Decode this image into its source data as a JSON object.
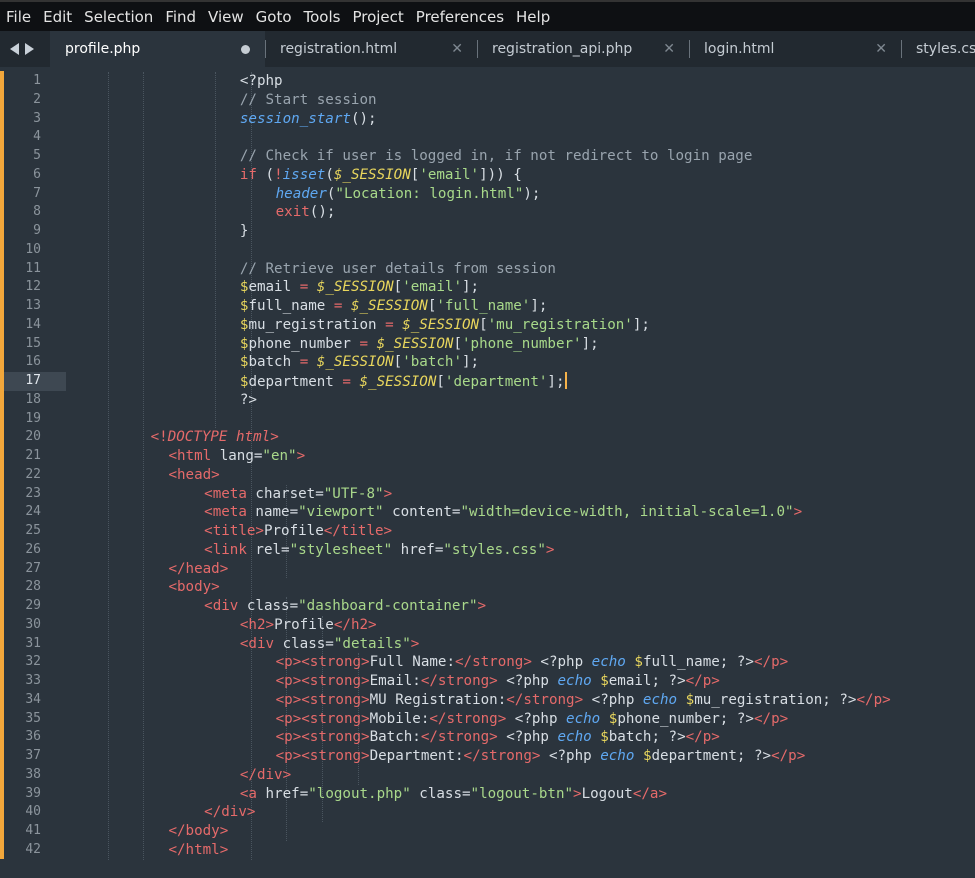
{
  "menu": [
    "File",
    "Edit",
    "Selection",
    "Find",
    "View",
    "Goto",
    "Tools",
    "Project",
    "Preferences",
    "Help"
  ],
  "tabs": [
    {
      "label": "profile.php",
      "active": true,
      "modified": true
    },
    {
      "label": "registration.html",
      "active": false,
      "modified": false
    },
    {
      "label": "registration_api.php",
      "active": false,
      "modified": false
    },
    {
      "label": "login.html",
      "active": false,
      "modified": false
    },
    {
      "label": "styles.css",
      "active": false,
      "modified": false
    }
  ],
  "editor": {
    "active_line": 17,
    "line_numbers": [
      "1",
      "2",
      "3",
      "4",
      "5",
      "6",
      "7",
      "8",
      "9",
      "10",
      "11",
      "12",
      "13",
      "14",
      "15",
      "16",
      "17",
      "18",
      "19",
      "20",
      "21",
      "22",
      "23",
      "24",
      "25",
      "26",
      "27",
      "28",
      "29",
      "30",
      "31",
      "32",
      "33",
      "34",
      "35",
      "36",
      "37",
      "38",
      "39",
      "40",
      "41",
      "42"
    ],
    "lines": [
      [
        [
          30,
          "php",
          "<?php"
        ]
      ],
      [
        [
          30,
          "comment",
          "// Start session"
        ]
      ],
      [
        [
          30,
          "func",
          "session_start"
        ],
        [
          0,
          "php",
          "();"
        ]
      ],
      [],
      [
        [
          30,
          "comment",
          "// Check if user is logged in, if not redirect to login page"
        ]
      ],
      [
        [
          30,
          "keyword",
          "if"
        ],
        [
          0,
          "php",
          " ("
        ],
        [
          0,
          "keyword",
          "!"
        ],
        [
          0,
          "func",
          "isset"
        ],
        [
          0,
          "php",
          "("
        ],
        [
          0,
          "super",
          "$_SESSION"
        ],
        [
          0,
          "php",
          "["
        ],
        [
          0,
          "string",
          "'email'"
        ],
        [
          0,
          "php",
          "])) {"
        ]
      ],
      [
        [
          34,
          "func",
          "header"
        ],
        [
          0,
          "php",
          "("
        ],
        [
          0,
          "string",
          "\"Location: login.html\""
        ],
        [
          0,
          "php",
          ");"
        ]
      ],
      [
        [
          34,
          "keyword",
          "exit"
        ],
        [
          0,
          "php",
          "();"
        ]
      ],
      [
        [
          30,
          "php",
          "}"
        ]
      ],
      [],
      [
        [
          30,
          "comment",
          "// Retrieve user details from session"
        ]
      ],
      [
        [
          30,
          "dollar",
          "$"
        ],
        [
          0,
          "php",
          "email "
        ],
        [
          0,
          "keyword",
          "="
        ],
        [
          0,
          "php",
          " "
        ],
        [
          0,
          "super",
          "$_SESSION"
        ],
        [
          0,
          "php",
          "["
        ],
        [
          0,
          "string",
          "'email'"
        ],
        [
          0,
          "php",
          "];"
        ]
      ],
      [
        [
          30,
          "dollar",
          "$"
        ],
        [
          0,
          "php",
          "full_name "
        ],
        [
          0,
          "keyword",
          "="
        ],
        [
          0,
          "php",
          " "
        ],
        [
          0,
          "super",
          "$_SESSION"
        ],
        [
          0,
          "php",
          "["
        ],
        [
          0,
          "string",
          "'full_name'"
        ],
        [
          0,
          "php",
          "];"
        ]
      ],
      [
        [
          30,
          "dollar",
          "$"
        ],
        [
          0,
          "php",
          "mu_registration "
        ],
        [
          0,
          "keyword",
          "="
        ],
        [
          0,
          "php",
          " "
        ],
        [
          0,
          "super",
          "$_SESSION"
        ],
        [
          0,
          "php",
          "["
        ],
        [
          0,
          "string",
          "'mu_registration'"
        ],
        [
          0,
          "php",
          "];"
        ]
      ],
      [
        [
          30,
          "dollar",
          "$"
        ],
        [
          0,
          "php",
          "phone_number "
        ],
        [
          0,
          "keyword",
          "="
        ],
        [
          0,
          "php",
          " "
        ],
        [
          0,
          "super",
          "$_SESSION"
        ],
        [
          0,
          "php",
          "["
        ],
        [
          0,
          "string",
          "'phone_number'"
        ],
        [
          0,
          "php",
          "];"
        ]
      ],
      [
        [
          30,
          "dollar",
          "$"
        ],
        [
          0,
          "php",
          "batch "
        ],
        [
          0,
          "keyword",
          "="
        ],
        [
          0,
          "php",
          " "
        ],
        [
          0,
          "super",
          "$_SESSION"
        ],
        [
          0,
          "php",
          "["
        ],
        [
          0,
          "string",
          "'batch'"
        ],
        [
          0,
          "php",
          "];"
        ]
      ],
      [
        [
          30,
          "dollar",
          "$"
        ],
        [
          0,
          "php",
          "department "
        ],
        [
          0,
          "keyword",
          "="
        ],
        [
          0,
          "php",
          " "
        ],
        [
          0,
          "super",
          "$_SESSION"
        ],
        [
          0,
          "php",
          "["
        ],
        [
          0,
          "string",
          "'department'"
        ],
        [
          0,
          "php",
          "];"
        ]
      ],
      [
        [
          30,
          "php",
          "?>"
        ]
      ],
      [],
      [
        [
          20,
          "tag",
          "<!"
        ],
        [
          0,
          "doctype",
          "DOCTYPE html"
        ],
        [
          0,
          "tag",
          ">"
        ]
      ],
      [
        [
          22,
          "tag",
          "<html"
        ],
        [
          0,
          "text",
          " lang="
        ],
        [
          0,
          "attr",
          "\"en\""
        ],
        [
          0,
          "tag",
          ">"
        ]
      ],
      [
        [
          22,
          "tag",
          "<head>"
        ]
      ],
      [
        [
          26,
          "tag",
          "<meta"
        ],
        [
          0,
          "text",
          " charset="
        ],
        [
          0,
          "attr",
          "\"UTF-8\""
        ],
        [
          0,
          "tag",
          ">"
        ]
      ],
      [
        [
          26,
          "tag",
          "<meta"
        ],
        [
          0,
          "text",
          " name="
        ],
        [
          0,
          "attr",
          "\"viewport\""
        ],
        [
          0,
          "text",
          " content="
        ],
        [
          0,
          "attr",
          "\"width=device-width, initial-scale=1.0\""
        ],
        [
          0,
          "tag",
          ">"
        ]
      ],
      [
        [
          26,
          "tag",
          "<title>"
        ],
        [
          0,
          "text",
          "Profile"
        ],
        [
          0,
          "tag",
          "</title>"
        ]
      ],
      [
        [
          26,
          "tag",
          "<link"
        ],
        [
          0,
          "text",
          " rel="
        ],
        [
          0,
          "attr",
          "\"stylesheet\""
        ],
        [
          0,
          "text",
          " href="
        ],
        [
          0,
          "attr",
          "\"styles.css\""
        ],
        [
          0,
          "tag",
          ">"
        ]
      ],
      [
        [
          22,
          "tag",
          "</head>"
        ]
      ],
      [
        [
          22,
          "tag",
          "<body>"
        ]
      ],
      [
        [
          26,
          "tag",
          "<div"
        ],
        [
          0,
          "text",
          " class="
        ],
        [
          0,
          "attr",
          "\"dashboard-container\""
        ],
        [
          0,
          "tag",
          ">"
        ]
      ],
      [
        [
          30,
          "tag",
          "<h2>"
        ],
        [
          0,
          "text",
          "Profile"
        ],
        [
          0,
          "tag",
          "</h2>"
        ]
      ],
      [
        [
          30,
          "tag",
          "<div"
        ],
        [
          0,
          "text",
          " class="
        ],
        [
          0,
          "attr",
          "\"details\""
        ],
        [
          0,
          "tag",
          ">"
        ]
      ],
      [
        [
          34,
          "tag",
          "<p><strong>"
        ],
        [
          0,
          "text",
          "Full Name:"
        ],
        [
          0,
          "tag",
          "</strong>"
        ],
        [
          0,
          "text",
          " <?php "
        ],
        [
          0,
          "echo",
          "echo"
        ],
        [
          0,
          "text",
          " "
        ],
        [
          0,
          "dollar",
          "$"
        ],
        [
          0,
          "text",
          "full_name; ?>"
        ],
        [
          0,
          "tag",
          "</p>"
        ]
      ],
      [
        [
          34,
          "tag",
          "<p><strong>"
        ],
        [
          0,
          "text",
          "Email:"
        ],
        [
          0,
          "tag",
          "</strong>"
        ],
        [
          0,
          "text",
          " <?php "
        ],
        [
          0,
          "echo",
          "echo"
        ],
        [
          0,
          "text",
          " "
        ],
        [
          0,
          "dollar",
          "$"
        ],
        [
          0,
          "text",
          "email; ?>"
        ],
        [
          0,
          "tag",
          "</p>"
        ]
      ],
      [
        [
          34,
          "tag",
          "<p><strong>"
        ],
        [
          0,
          "text",
          "MU Registration:"
        ],
        [
          0,
          "tag",
          "</strong>"
        ],
        [
          0,
          "text",
          " <?php "
        ],
        [
          0,
          "echo",
          "echo"
        ],
        [
          0,
          "text",
          " "
        ],
        [
          0,
          "dollar",
          "$"
        ],
        [
          0,
          "text",
          "mu_registration; ?>"
        ],
        [
          0,
          "tag",
          "</p>"
        ]
      ],
      [
        [
          34,
          "tag",
          "<p><strong>"
        ],
        [
          0,
          "text",
          "Mobile:"
        ],
        [
          0,
          "tag",
          "</strong>"
        ],
        [
          0,
          "text",
          " <?php "
        ],
        [
          0,
          "echo",
          "echo"
        ],
        [
          0,
          "text",
          " "
        ],
        [
          0,
          "dollar",
          "$"
        ],
        [
          0,
          "text",
          "phone_number; ?>"
        ],
        [
          0,
          "tag",
          "</p>"
        ]
      ],
      [
        [
          34,
          "tag",
          "<p><strong>"
        ],
        [
          0,
          "text",
          "Batch:"
        ],
        [
          0,
          "tag",
          "</strong>"
        ],
        [
          0,
          "text",
          " <?php "
        ],
        [
          0,
          "echo",
          "echo"
        ],
        [
          0,
          "text",
          " "
        ],
        [
          0,
          "dollar",
          "$"
        ],
        [
          0,
          "text",
          "batch; ?>"
        ],
        [
          0,
          "tag",
          "</p>"
        ]
      ],
      [
        [
          34,
          "tag",
          "<p><strong>"
        ],
        [
          0,
          "text",
          "Department:"
        ],
        [
          0,
          "tag",
          "</strong>"
        ],
        [
          0,
          "text",
          " <?php "
        ],
        [
          0,
          "echo",
          "echo"
        ],
        [
          0,
          "text",
          " "
        ],
        [
          0,
          "dollar",
          "$"
        ],
        [
          0,
          "text",
          "department; ?>"
        ],
        [
          0,
          "tag",
          "</p>"
        ]
      ],
      [
        [
          30,
          "tag",
          "</div>"
        ]
      ],
      [
        [
          30,
          "tag",
          "<a"
        ],
        [
          0,
          "text",
          " href="
        ],
        [
          0,
          "attr",
          "\"logout.php\""
        ],
        [
          0,
          "text",
          " class="
        ],
        [
          0,
          "attr",
          "\"logout-btn\""
        ],
        [
          0,
          "tag",
          ">"
        ],
        [
          0,
          "text",
          "Logout"
        ],
        [
          0,
          "tag",
          "</a>"
        ]
      ],
      [
        [
          26,
          "tag",
          "</div>"
        ]
      ],
      [
        [
          22,
          "tag",
          "</body>"
        ]
      ],
      [
        [
          22,
          "tag",
          "</html>"
        ]
      ]
    ]
  }
}
